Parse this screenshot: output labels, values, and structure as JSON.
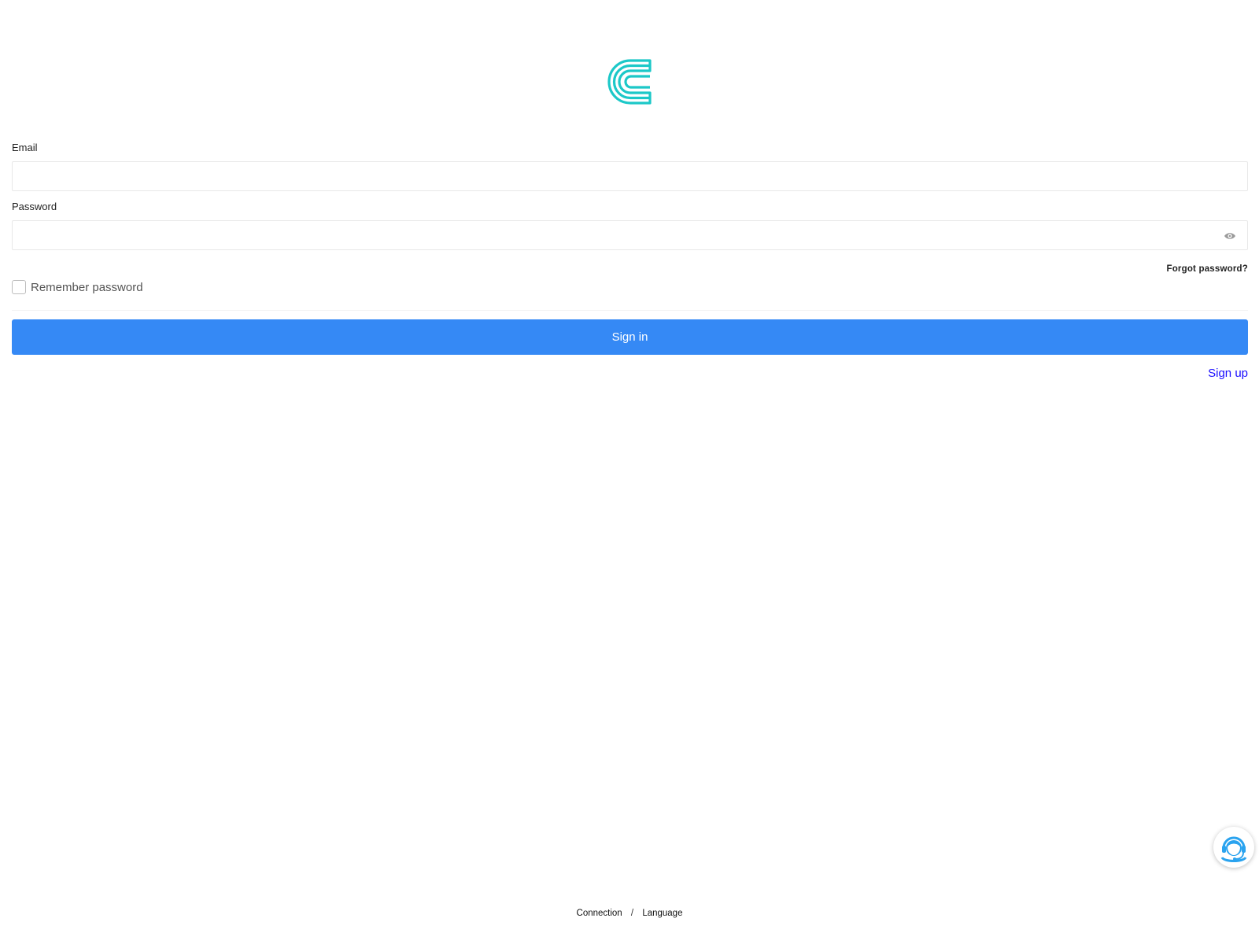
{
  "brand": {
    "logo_icon": "c-logo-icon",
    "logo_color": "#1cc8c8"
  },
  "form": {
    "email_label": "Email",
    "email_value": "",
    "password_label": "Password",
    "password_value": "",
    "password_toggle_icon": "eye-icon",
    "forgot_password": "Forgot password?",
    "remember_label": "Remember password",
    "remember_checked": false,
    "signin_label": "Sign in",
    "signin_color": "#3589f5",
    "signup_label": "Sign up",
    "signup_color": "#1a0dff"
  },
  "footer": {
    "connection": "Connection",
    "separator": "/",
    "language": "Language"
  },
  "support": {
    "icon": "customer-support-icon",
    "color": "#2aa3ef"
  }
}
